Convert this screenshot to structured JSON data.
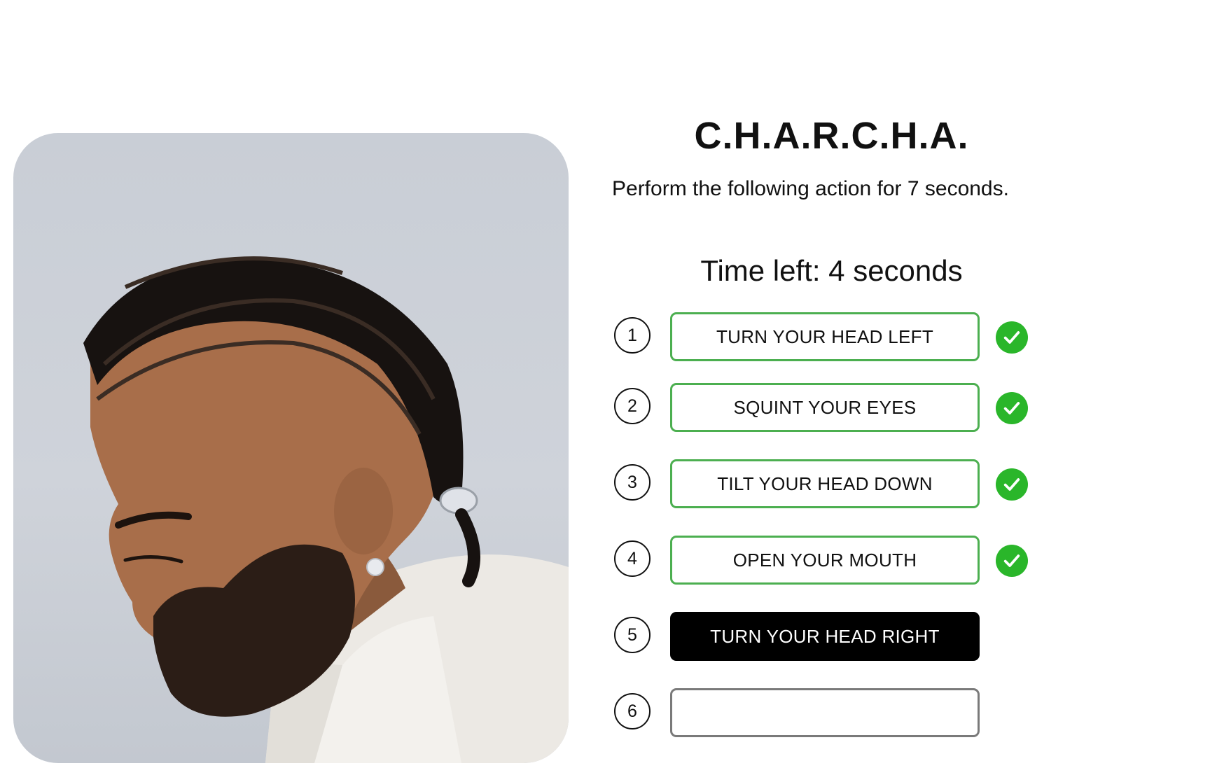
{
  "app": {
    "title": "C.H.A.R.C.H.A.",
    "subtitle": "Perform the following action for 7 seconds.",
    "timer_text": "Time left: 4 seconds"
  },
  "photo": {
    "icon": "person-profile-photo"
  },
  "steps": [
    {
      "number": "1",
      "label": "TURN YOUR HEAD LEFT",
      "status": "done"
    },
    {
      "number": "2",
      "label": "SQUINT YOUR EYES",
      "status": "done"
    },
    {
      "number": "3",
      "label": "TILT YOUR HEAD DOWN",
      "status": "done"
    },
    {
      "number": "4",
      "label": "OPEN YOUR MOUTH",
      "status": "done"
    },
    {
      "number": "5",
      "label": "TURN YOUR HEAD RIGHT",
      "status": "active"
    },
    {
      "number": "6",
      "label": "",
      "status": "pending"
    }
  ],
  "colors": {
    "done_border": "#4caf50",
    "check_fill": "#2ab62a",
    "active_fill": "#000000",
    "pending_border": "#7a7a7a"
  }
}
